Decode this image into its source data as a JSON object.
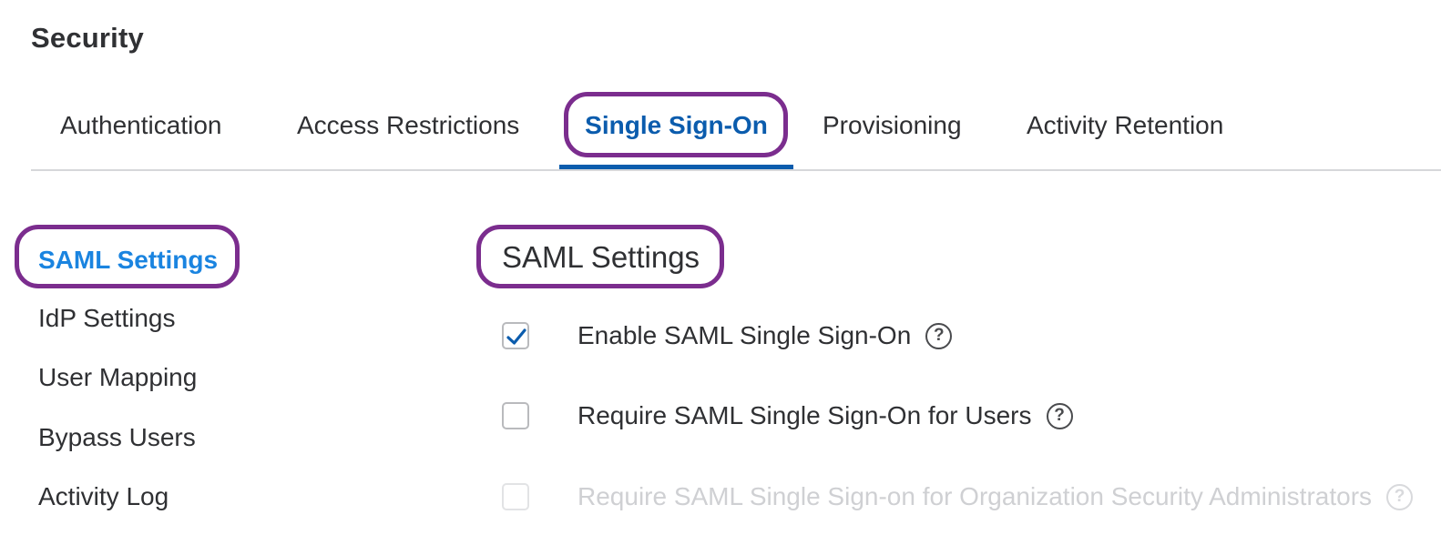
{
  "page": {
    "title": "Security"
  },
  "tabs": [
    {
      "label": "Authentication"
    },
    {
      "label": "Access Restrictions"
    },
    {
      "label": "Single Sign-On",
      "active": true
    },
    {
      "label": "Provisioning"
    },
    {
      "label": "Activity Retention"
    }
  ],
  "sidebar": {
    "items": [
      {
        "label": "SAML Settings",
        "active": true
      },
      {
        "label": "IdP Settings"
      },
      {
        "label": "User Mapping"
      },
      {
        "label": "Bypass Users"
      },
      {
        "label": "Activity Log"
      }
    ]
  },
  "main": {
    "section_title": "SAML Settings",
    "options": [
      {
        "label": "Enable SAML Single Sign-On",
        "checked": true,
        "disabled": false,
        "help_icon": "question-circle-icon"
      },
      {
        "label": "Require SAML Single Sign-On for Users",
        "checked": false,
        "disabled": false,
        "help_icon": "question-circle-icon"
      },
      {
        "label": "Require SAML Single Sign-on for Organization Security Administrators",
        "checked": false,
        "disabled": true,
        "help_icon": "question-circle-icon"
      }
    ],
    "help_glyph": "?"
  },
  "colors": {
    "active_tab": "#0b5cad",
    "active_sidebar": "#1a84e0",
    "highlight_outline": "#7b2d8e",
    "checkmark": "#0b5cad"
  }
}
